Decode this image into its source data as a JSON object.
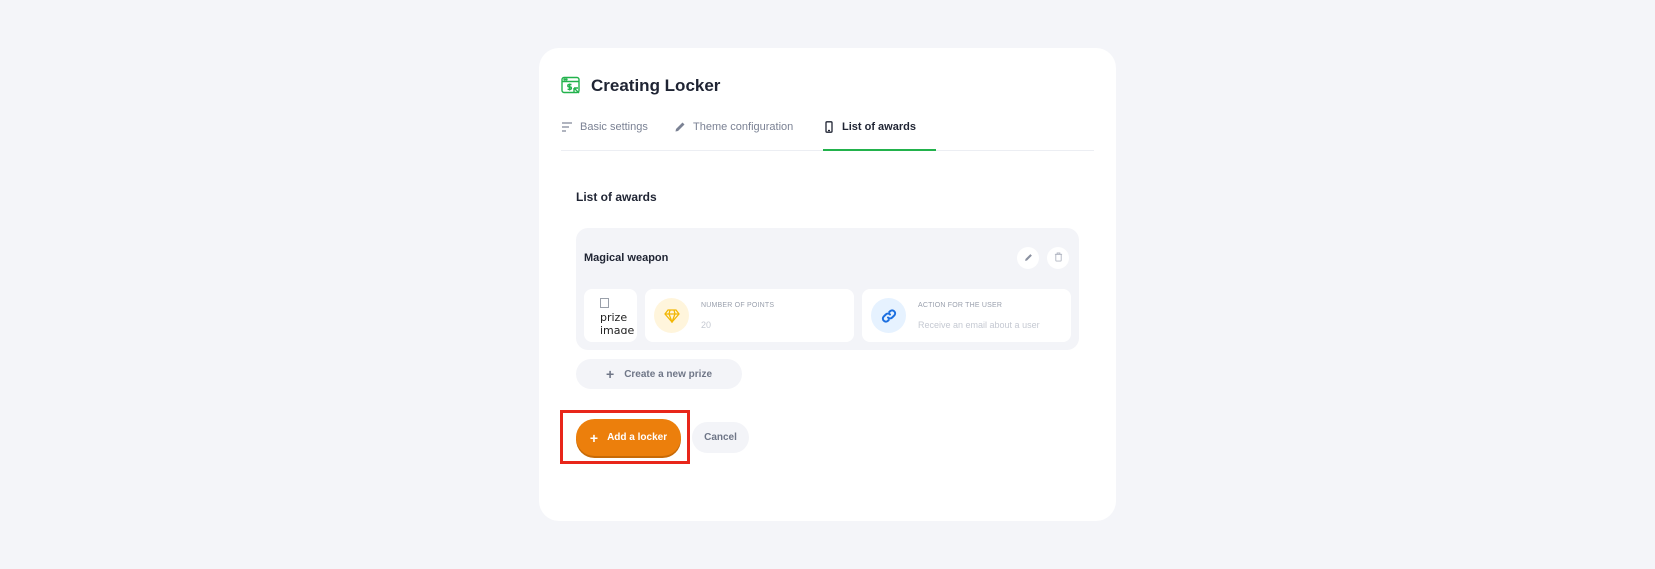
{
  "header": {
    "title": "Creating Locker",
    "icon": "browser-dollar-icon",
    "accent": "#22b24c"
  },
  "tabs": [
    {
      "label": "Basic settings",
      "icon": "sort-lines-icon",
      "active": false
    },
    {
      "label": "Theme configuration",
      "icon": "pencil-icon",
      "active": false
    },
    {
      "label": "List of awards",
      "icon": "phone-icon",
      "active": true
    }
  ],
  "awards": {
    "section_title": "List of awards",
    "prize": {
      "name": "Magical weapon",
      "image_alt": "prize image",
      "points_label": "NUMBER OF POINTS",
      "points_value": "20",
      "action_label": "ACTION FOR THE USER",
      "action_value": "Receive an email about a user"
    },
    "create_prize_label": "Create a new prize"
  },
  "actions": {
    "add_label": "Add a locker",
    "cancel_label": "Cancel",
    "add_color": "#ec7f0c",
    "highlight_color": "#e8261a"
  }
}
